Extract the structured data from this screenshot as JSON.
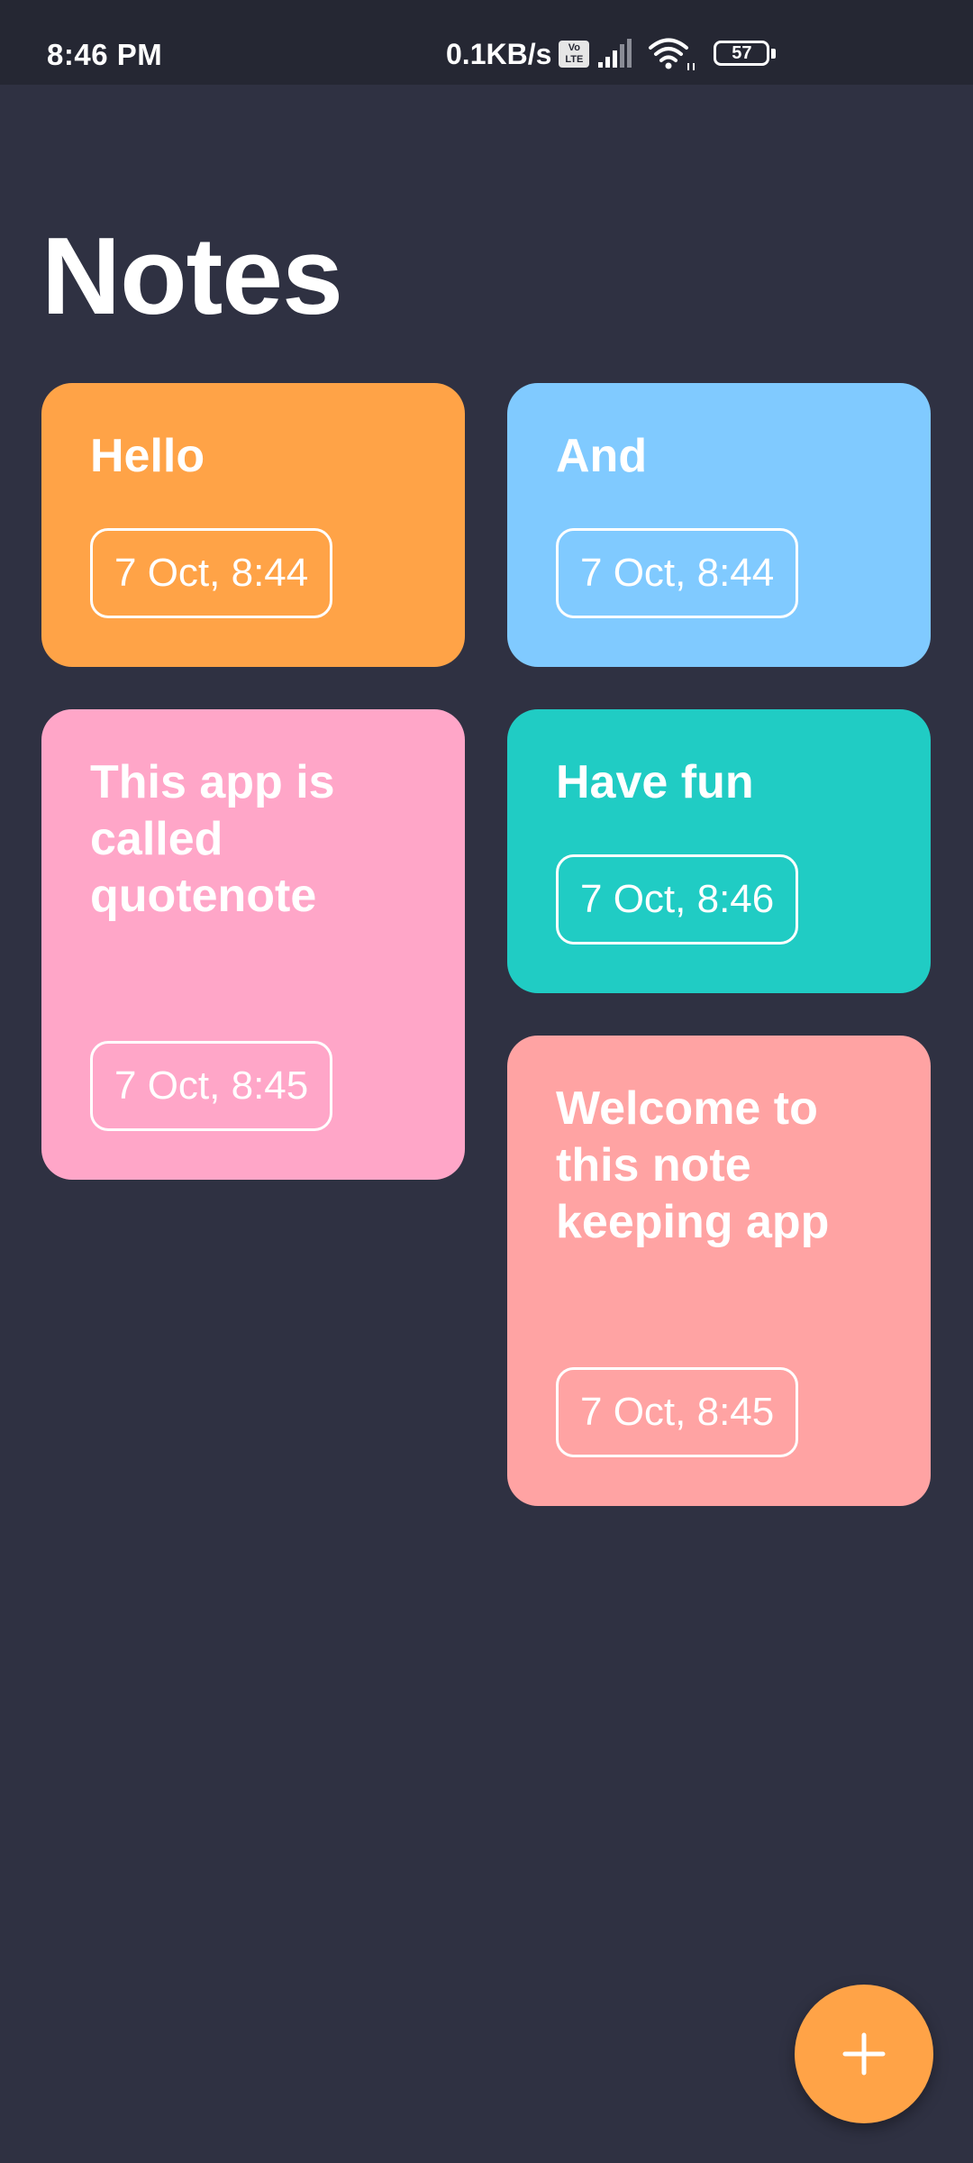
{
  "status_bar": {
    "time": "8:46 PM",
    "network_speed": "0.1KB/s",
    "volte_label_top": "Vo",
    "volte_label_bottom": "LTE",
    "battery_level": "57"
  },
  "page_title": "Notes",
  "notes": [
    {
      "title": "Hello",
      "date": "7 Oct, 8:44",
      "color": "#ffa347"
    },
    {
      "title": "And",
      "date": "7 Oct, 8:44",
      "color": "#80caff"
    },
    {
      "title": "This app is called quotenote",
      "date": "7 Oct, 8:45",
      "color": "#ffa6c8"
    },
    {
      "title": "Have fun",
      "date": "7 Oct, 8:46",
      "color": "#20ccc4"
    },
    {
      "title": "Welcome to this note keeping app",
      "date": "7 Oct, 8:45",
      "color": "#ffa3a3"
    }
  ],
  "fab": {
    "icon": "plus-icon",
    "color": "#ffa347"
  },
  "colors": {
    "background": "#2f3142",
    "status_bar": "#252733"
  }
}
